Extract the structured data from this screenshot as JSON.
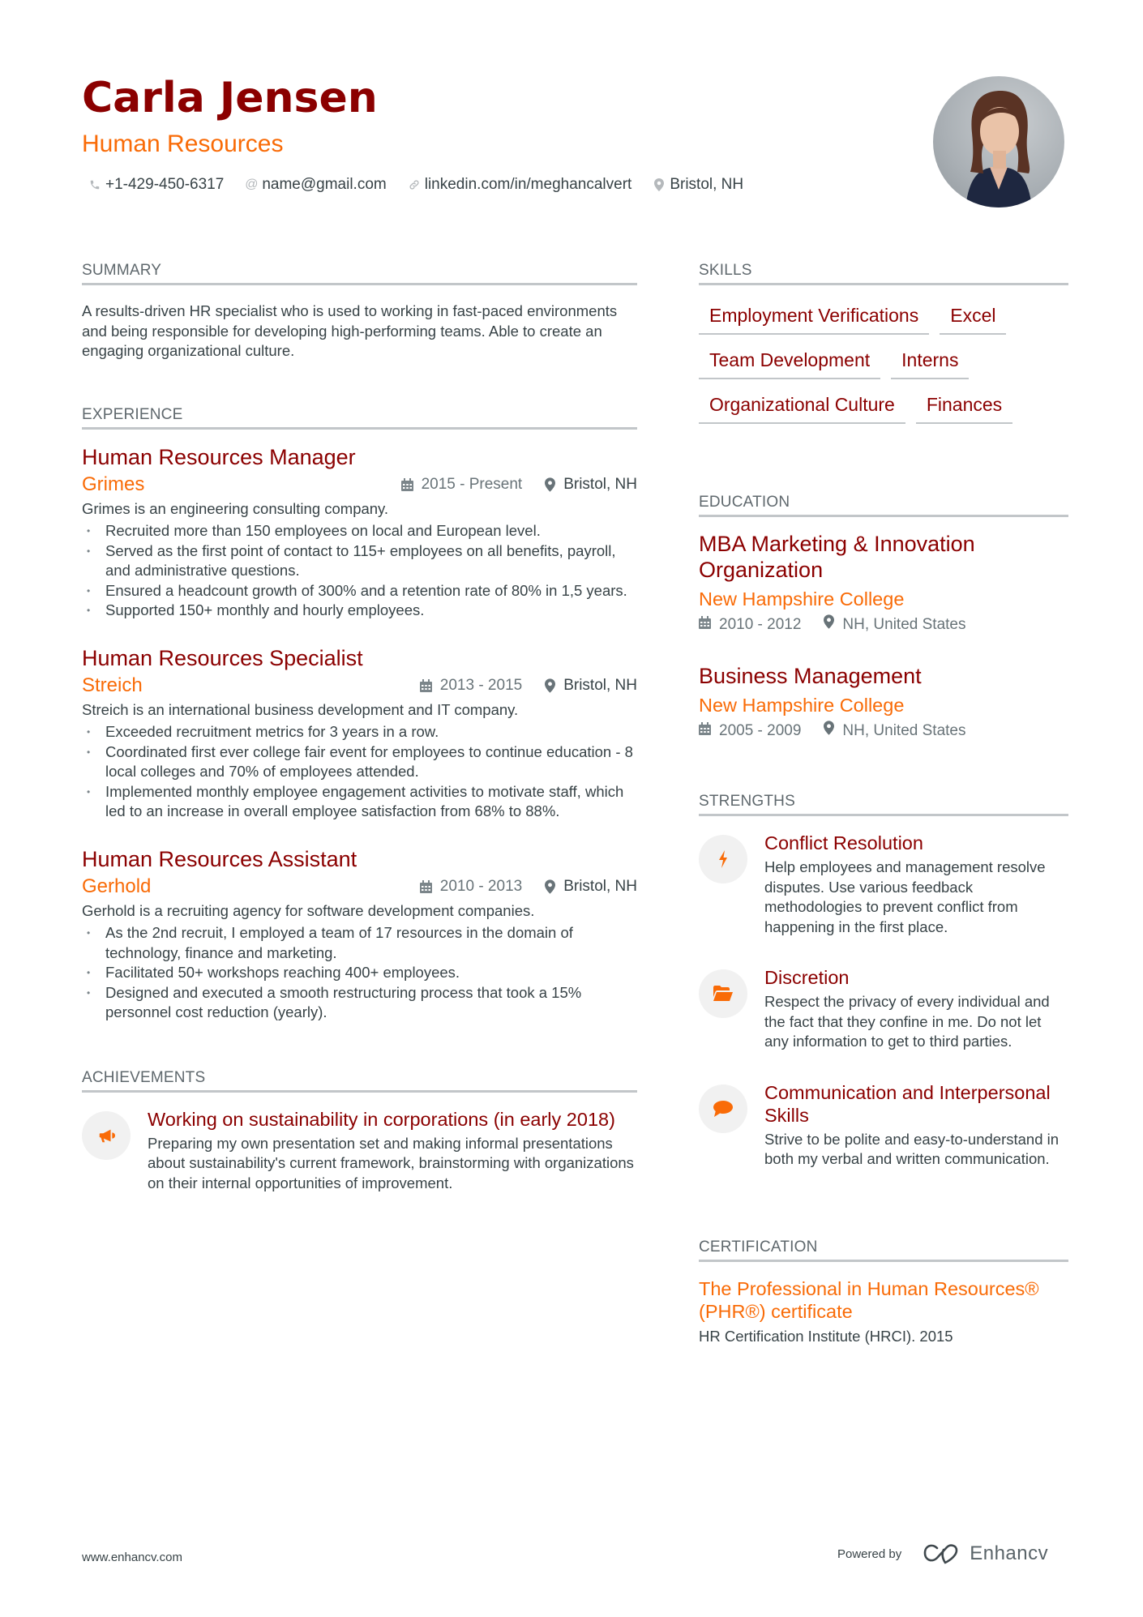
{
  "header": {
    "name": "Carla Jensen",
    "role": "Human Resources",
    "contacts": [
      {
        "icon": "phone-icon",
        "text": "+1-429-450-6317"
      },
      {
        "icon": "at-icon",
        "text": "name@gmail.com"
      },
      {
        "icon": "link-icon",
        "text": "linkedin.com/in/meghancalvert"
      },
      {
        "icon": "location-icon",
        "text": "Bristol, NH"
      }
    ]
  },
  "summary": {
    "title": "SUMMARY",
    "text": "A results-driven HR specialist who is used to working in fast-paced environments and being responsible for developing high-performing teams. Able to create an engaging organizational culture."
  },
  "experience": {
    "title": "EXPERIENCE",
    "jobs": [
      {
        "title": "Human Resources Manager",
        "company": "Grimes",
        "dates": "2015 - Present",
        "location": "Bristol, NH",
        "description": "Grimes is an engineering consulting company.",
        "bullets": [
          "Recruited more than 150 employees on local and European level.",
          "Served as the first point of contact to 115+ employees on all benefits, payroll, and administrative questions.",
          "Ensured a headcount growth of 300% and a retention rate of 80% in 1,5 years.",
          "Supported 150+ monthly and hourly employees."
        ]
      },
      {
        "title": "Human Resources Specialist",
        "company": "Streich",
        "dates": "2013 - 2015",
        "location": "Bristol, NH",
        "description": "Streich is an international business development and IT company.",
        "bullets": [
          "Exceeded recruitment metrics for 3 years in a row.",
          "Coordinated first ever college fair event for employees to continue education - 8 local colleges and 70% of employees attended.",
          "Implemented monthly employee engagement activities to motivate staff, which led to an increase in overall employee satisfaction from 68% to 88%."
        ]
      },
      {
        "title": "Human Resources Assistant",
        "company": "Gerhold",
        "dates": "2010 - 2013",
        "location": "Bristol, NH",
        "description": "Gerhold is a recruiting agency for software development companies.",
        "bullets": [
          "As the 2nd recruit, I employed a team of 17 resources in the domain of technology, finance and marketing.",
          "Facilitated 50+ workshops reaching 400+ employees.",
          "Designed and executed a smooth restructuring process that took a 15% personnel cost reduction (yearly)."
        ]
      }
    ]
  },
  "achievements": {
    "title": "ACHIEVEMENTS",
    "items": [
      {
        "icon": "megaphone-icon",
        "title": "Working on sustainability in corporations (in early 2018)",
        "description": "Preparing my own presentation set and making informal presentations about sustainability's current framework, brainstorming with organizations on their internal opportunities of improvement."
      }
    ]
  },
  "skills": {
    "title": "SKILLS",
    "items": [
      "Employment Verifications",
      "Excel",
      "Team Development",
      "Interns",
      "Organizational Culture",
      "Finances"
    ]
  },
  "education": {
    "title": "EDUCATION",
    "items": [
      {
        "degree": "MBA Marketing & Innovation Organization",
        "school": "New Hampshire College",
        "dates": "2010 - 2012",
        "location": "NH, United States"
      },
      {
        "degree": "Business Management",
        "school": "New Hampshire College",
        "dates": "2005 - 2009",
        "location": "NH, United States"
      }
    ]
  },
  "strengths": {
    "title": "STRENGTHS",
    "items": [
      {
        "icon": "lightning-icon",
        "title": "Conflict Resolution",
        "description": "Help employees and management resolve disputes. Use various feedback methodologies to prevent conflict from happening in the first place."
      },
      {
        "icon": "folder-open-icon",
        "title": "Discretion",
        "description": "Respect the privacy of every individual and the fact that they confine in me. Do not let any information to get to third parties."
      },
      {
        "icon": "speech-bubble-icon",
        "title": "Communication and Interpersonal Skills",
        "description": "Strive to be polite and easy-to-understand in both my verbal and written communication."
      }
    ]
  },
  "certification": {
    "title": "CERTIFICATION",
    "items": [
      {
        "title": "The Professional in Human Resources® (PHR®) certificate",
        "issuer": "HR Certification Institute (HRCI). 2015"
      }
    ]
  },
  "footer": {
    "website": "www.enhancv.com",
    "powered_by": "Powered by",
    "brand": "Enhancv"
  },
  "colors": {
    "primary": "#8b0000",
    "accent": "#f96b07",
    "text": "#384347",
    "muted": "#687378"
  }
}
